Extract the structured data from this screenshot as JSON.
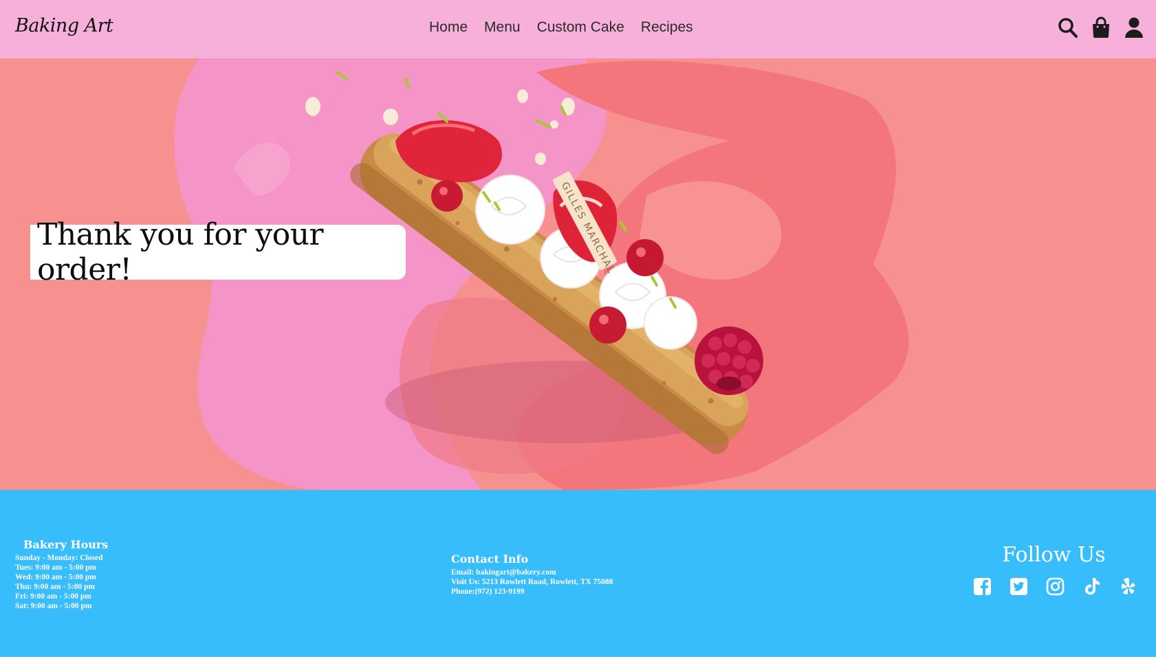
{
  "header": {
    "logo": "Baking Art",
    "nav": [
      "Home",
      "Menu",
      "Custom Cake",
      "Recipes"
    ],
    "icons": [
      "search-icon",
      "shopping-bag-icon",
      "user-icon"
    ]
  },
  "hero": {
    "message": "Thank you for your order!",
    "image_text": "GILLES MARCHAL"
  },
  "footer": {
    "hours": {
      "title": "Bakery Hours",
      "lines": [
        "Sunday - Monday: Closed",
        "Tues: 9:00 am - 5:00 pm",
        "Wed: 9:00 am - 5:00 pm",
        "Thu: 9:00 am - 5:00 pm",
        "Fri: 9:00 am - 5:00 pm",
        "Sat: 9:00 am - 5:00 pm"
      ]
    },
    "contact": {
      "title": "Contact Info",
      "lines": [
        "Email: bakingart@bakery.com",
        "Visit Us: 5213 Rowlett Road, Rowlett, TX 75088",
        "Phone:(972) 123-9199"
      ]
    },
    "follow": {
      "title": "Follow Us",
      "icons": [
        "facebook-icon",
        "twitter-icon",
        "instagram-icon",
        "tiktok-icon",
        "yelp-icon"
      ]
    }
  },
  "colors": {
    "header_bg": "#f7b0d9",
    "hero_bg": "#f6918f",
    "footer_bg": "#38bdfc",
    "text_dark": "#111111",
    "text_light": "#ffffff"
  }
}
